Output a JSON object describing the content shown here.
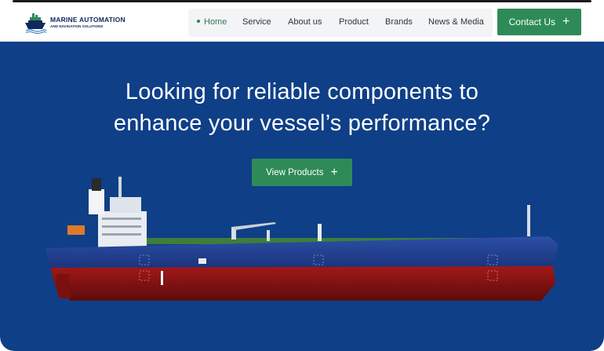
{
  "brand": {
    "name_line1": "MARINE AUTOMATION",
    "name_line2": "AND NAVIGATION SOLUTIONS"
  },
  "nav": {
    "items": [
      {
        "label": "Home",
        "active": true
      },
      {
        "label": "Service",
        "active": false
      },
      {
        "label": "About us",
        "active": false
      },
      {
        "label": "Product",
        "active": false
      },
      {
        "label": "Brands",
        "active": false
      },
      {
        "label": "News & Media",
        "active": false
      }
    ],
    "contact_label": "Contact Us"
  },
  "hero": {
    "headline_line1": "Looking for reliable components to",
    "headline_line2": "enhance your vessel’s performance?",
    "cta_label": "View Products"
  },
  "colors": {
    "hero_background": "#0f3f87",
    "accent_green": "#2e8b57",
    "brand_navy": "#0d2a5c",
    "hull_blue": "#1f3f8f",
    "hull_red": "#8e1414"
  },
  "icons": {
    "plus": "plus-icon",
    "logo": "ship-logo-icon"
  }
}
